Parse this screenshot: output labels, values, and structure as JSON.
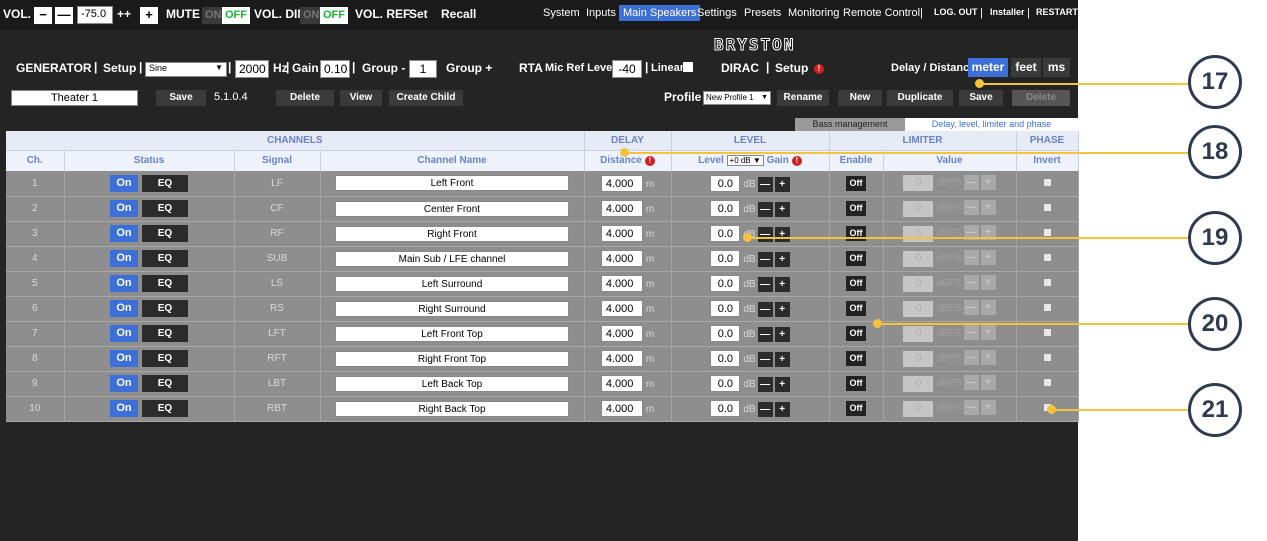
{
  "topbar": {
    "vol_label": "VOL.",
    "vol_minus": "−",
    "vol_minus_big": "—",
    "vol_value": "-75.0",
    "vol_plus_big": "++",
    "vol_plus": "+",
    "mute_label": "MUTE",
    "mute_on": "ON",
    "mute_off": "OFF",
    "voldim_label": "VOL. DIM",
    "voldim_on": "ON",
    "voldim_off": "OFF",
    "volref_label": "VOL. REF",
    "set_label": "Set",
    "recall_label": "Recall",
    "nav": [
      "System",
      "Inputs",
      "Main Speakers",
      "Settings",
      "Presets",
      "Monitoring",
      "Remote Control"
    ],
    "nav_active": "Main Speakers",
    "logout": "LOG. OUT",
    "installer": "Installer",
    "restart": "RESTART"
  },
  "brand": "BRYSTON",
  "generator": {
    "label": "GENERATOR",
    "setup": "Setup",
    "waveform": "Sine",
    "hz_value": "2000",
    "hz_unit": "Hz",
    "gain_label": "Gain",
    "gain_value": "0.10",
    "group_minus": "Group -",
    "group_value": "1",
    "group_plus": "Group +",
    "rta": "RTA",
    "mic_ref_label": "Mic Ref Level",
    "mic_ref_value": "-40",
    "linear": "Linear",
    "dirac": "DIRAC",
    "dirac_setup": "Setup",
    "delay_distance_label": "Delay / Distance",
    "unit_meter": "meter",
    "unit_feet": "feet",
    "unit_ms": "ms"
  },
  "profile_bar": {
    "name": "Theater 1",
    "save": "Save",
    "format": "5.1.0.4",
    "delete": "Delete",
    "view": "View",
    "create_child": "Create Child",
    "profile_label": "Profile :",
    "profile_select": "New Profile 1",
    "rename": "Rename",
    "new": "New",
    "duplicate": "Duplicate",
    "save2": "Save",
    "delete2": "Delete"
  },
  "tabs": {
    "bass": "Bass management",
    "delay": "Delay, level, limiter and phase"
  },
  "table": {
    "groups": {
      "channels": "CHANNELS",
      "delay": "DELAY",
      "level": "LEVEL",
      "limiter": "LIMITER",
      "phase": "PHASE"
    },
    "headers": {
      "ch": "Ch.",
      "status": "Status",
      "signal": "Signal",
      "name": "Channel Name",
      "distance": "Distance",
      "level": "Level",
      "level_select": "+0 dB",
      "gain": "Gain",
      "enable": "Enable",
      "value": "Value",
      "invert": "Invert"
    },
    "on_label": "On",
    "eq_label": "EQ",
    "dist_unit": "m",
    "db_unit": "dB",
    "off_label": "Off",
    "dbfs_unit": "dBFS",
    "rows": [
      {
        "ch": "1",
        "signal": "LF",
        "name": "Left Front",
        "distance": "4.000",
        "level": "0.0",
        "limit": "0"
      },
      {
        "ch": "2",
        "signal": "CF",
        "name": "Center Front",
        "distance": "4.000",
        "level": "0.0",
        "limit": "0"
      },
      {
        "ch": "3",
        "signal": "RF",
        "name": "Right Front",
        "distance": "4.000",
        "level": "0.0",
        "limit": "0"
      },
      {
        "ch": "4",
        "signal": "SUB",
        "name": "Main Sub / LFE channel",
        "distance": "4.000",
        "level": "0.0",
        "limit": "0"
      },
      {
        "ch": "5",
        "signal": "LS",
        "name": "Left Surround",
        "distance": "4.000",
        "level": "0.0",
        "limit": "0"
      },
      {
        "ch": "6",
        "signal": "RS",
        "name": "Right Surround",
        "distance": "4.000",
        "level": "0.0",
        "limit": "0"
      },
      {
        "ch": "7",
        "signal": "LFT",
        "name": "Left Front Top",
        "distance": "4.000",
        "level": "0.0",
        "limit": "0"
      },
      {
        "ch": "8",
        "signal": "RFT",
        "name": "Right Front Top",
        "distance": "4.000",
        "level": "0.0",
        "limit": "0"
      },
      {
        "ch": "9",
        "signal": "LBT",
        "name": "Left Back Top",
        "distance": "4.000",
        "level": "0.0",
        "limit": "0"
      },
      {
        "ch": "10",
        "signal": "RBT",
        "name": "Right Back Top",
        "distance": "4.000",
        "level": "0.0",
        "limit": "0"
      }
    ]
  },
  "callouts": [
    "17",
    "18",
    "19",
    "20",
    "21"
  ],
  "colors": {
    "accent_blue": "#3c6fd8",
    "callout_line": "#f5c23b",
    "callout_ring": "#2e3a4e",
    "off_green": "#19b33a"
  }
}
